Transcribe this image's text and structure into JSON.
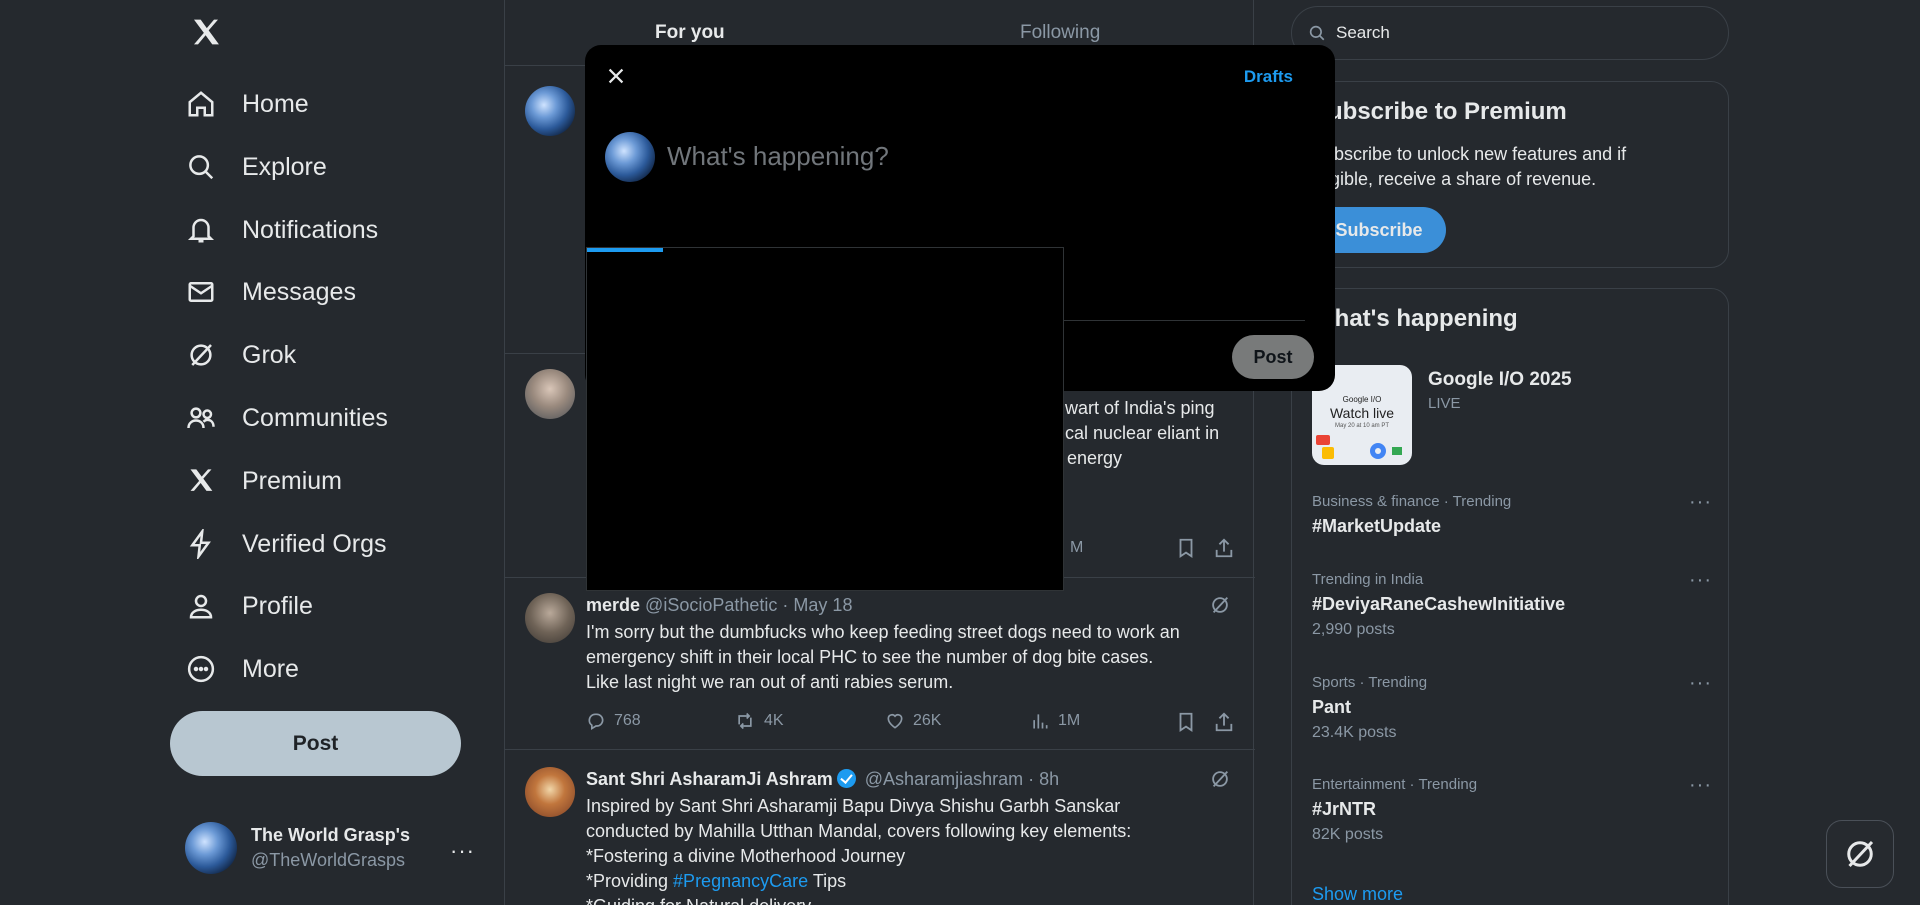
{
  "colors": {
    "background": "#25292e",
    "accent": "#1d9bf0",
    "modal_bg": "#000000",
    "post_button": "#b8c7d1",
    "subscribe_button": "#3b8fd8"
  },
  "sidebar": {
    "logo_icon": "x-logo-icon",
    "items": [
      {
        "label": "Home",
        "icon": "home-icon"
      },
      {
        "label": "Explore",
        "icon": "search-icon"
      },
      {
        "label": "Notifications",
        "icon": "bell-icon"
      },
      {
        "label": "Messages",
        "icon": "mail-icon"
      },
      {
        "label": "Grok",
        "icon": "grok-icon"
      },
      {
        "label": "Communities",
        "icon": "people-icon"
      },
      {
        "label": "Premium",
        "icon": "x-logo-icon"
      },
      {
        "label": "Verified Orgs",
        "icon": "lightning-icon"
      },
      {
        "label": "Profile",
        "icon": "person-icon"
      },
      {
        "label": "More",
        "icon": "more-circle-icon"
      }
    ],
    "post_label": "Post",
    "account": {
      "name": "The World Grasp's",
      "handle": "@TheWorldGrasps",
      "more": "···"
    }
  },
  "main": {
    "tabs": [
      {
        "label": "For you"
      },
      {
        "label": "Following"
      }
    ],
    "partial_post": {
      "lines": [
        "stalwart of India's",
        "ping critical nuclear",
        "eliant in the energy"
      ],
      "views_fragment": "M"
    },
    "posts": [
      {
        "author": "merde",
        "handle": "@iSocioPathetic",
        "time": "May 18",
        "lines": [
          "I'm sorry but the dumbfucks who keep feeding street dogs need to work an",
          "emergency shift in their local PHC to see the number of dog bite cases.",
          "Like last night we ran out of anti rabies serum."
        ],
        "replies": "768",
        "reposts": "4K",
        "likes": "26K",
        "views": "1M"
      },
      {
        "author": "Sant Shri AsharamJi Ashram",
        "handle": "@Asharamjiashram",
        "time": "8h",
        "line1": "Inspired by Sant Shri Asharamji Bapu Divya Shishu Garbh Sanskar",
        "line2": "conducted by Mahilla Utthan Mandal, covers following key elements:",
        "line3": "*Fostering a divine Motherhood Journey",
        "line4_prefix": "*Providing ",
        "line4_hashtag": "#PregnancyCare",
        "line4_suffix": " Tips",
        "line5": "*Guiding for Natural delivery"
      }
    ]
  },
  "right": {
    "search": {
      "placeholder": "Search"
    },
    "premium": {
      "title": "Subscribe to Premium",
      "body": "Subscribe to unlock new features and if eligible, receive a share of revenue.",
      "button": "Subscribe"
    },
    "trends": {
      "title": "What's happening",
      "event": {
        "title": "Google I/O 2025",
        "status": "LIVE",
        "image_brand": "Google I/O",
        "image_title": "Watch live",
        "image_date": "May 20 at 10 am PT"
      },
      "items": [
        {
          "context": "Business & finance · Trending",
          "name": "#MarketUpdate",
          "count": ""
        },
        {
          "context": "Trending in India",
          "name": "#DeviyaRaneCashewInitiative",
          "count": "2,990 posts"
        },
        {
          "context": "Sports · Trending",
          "name": "Pant",
          "count": "23.4K posts"
        },
        {
          "context": "Entertainment · Trending",
          "name": "#JrNTR",
          "count": "82K posts"
        }
      ],
      "show_more": "Show more"
    }
  },
  "compose": {
    "drafts": "Drafts",
    "placeholder": "What's happening?",
    "post": "Post",
    "upload_progress": 0.16
  }
}
